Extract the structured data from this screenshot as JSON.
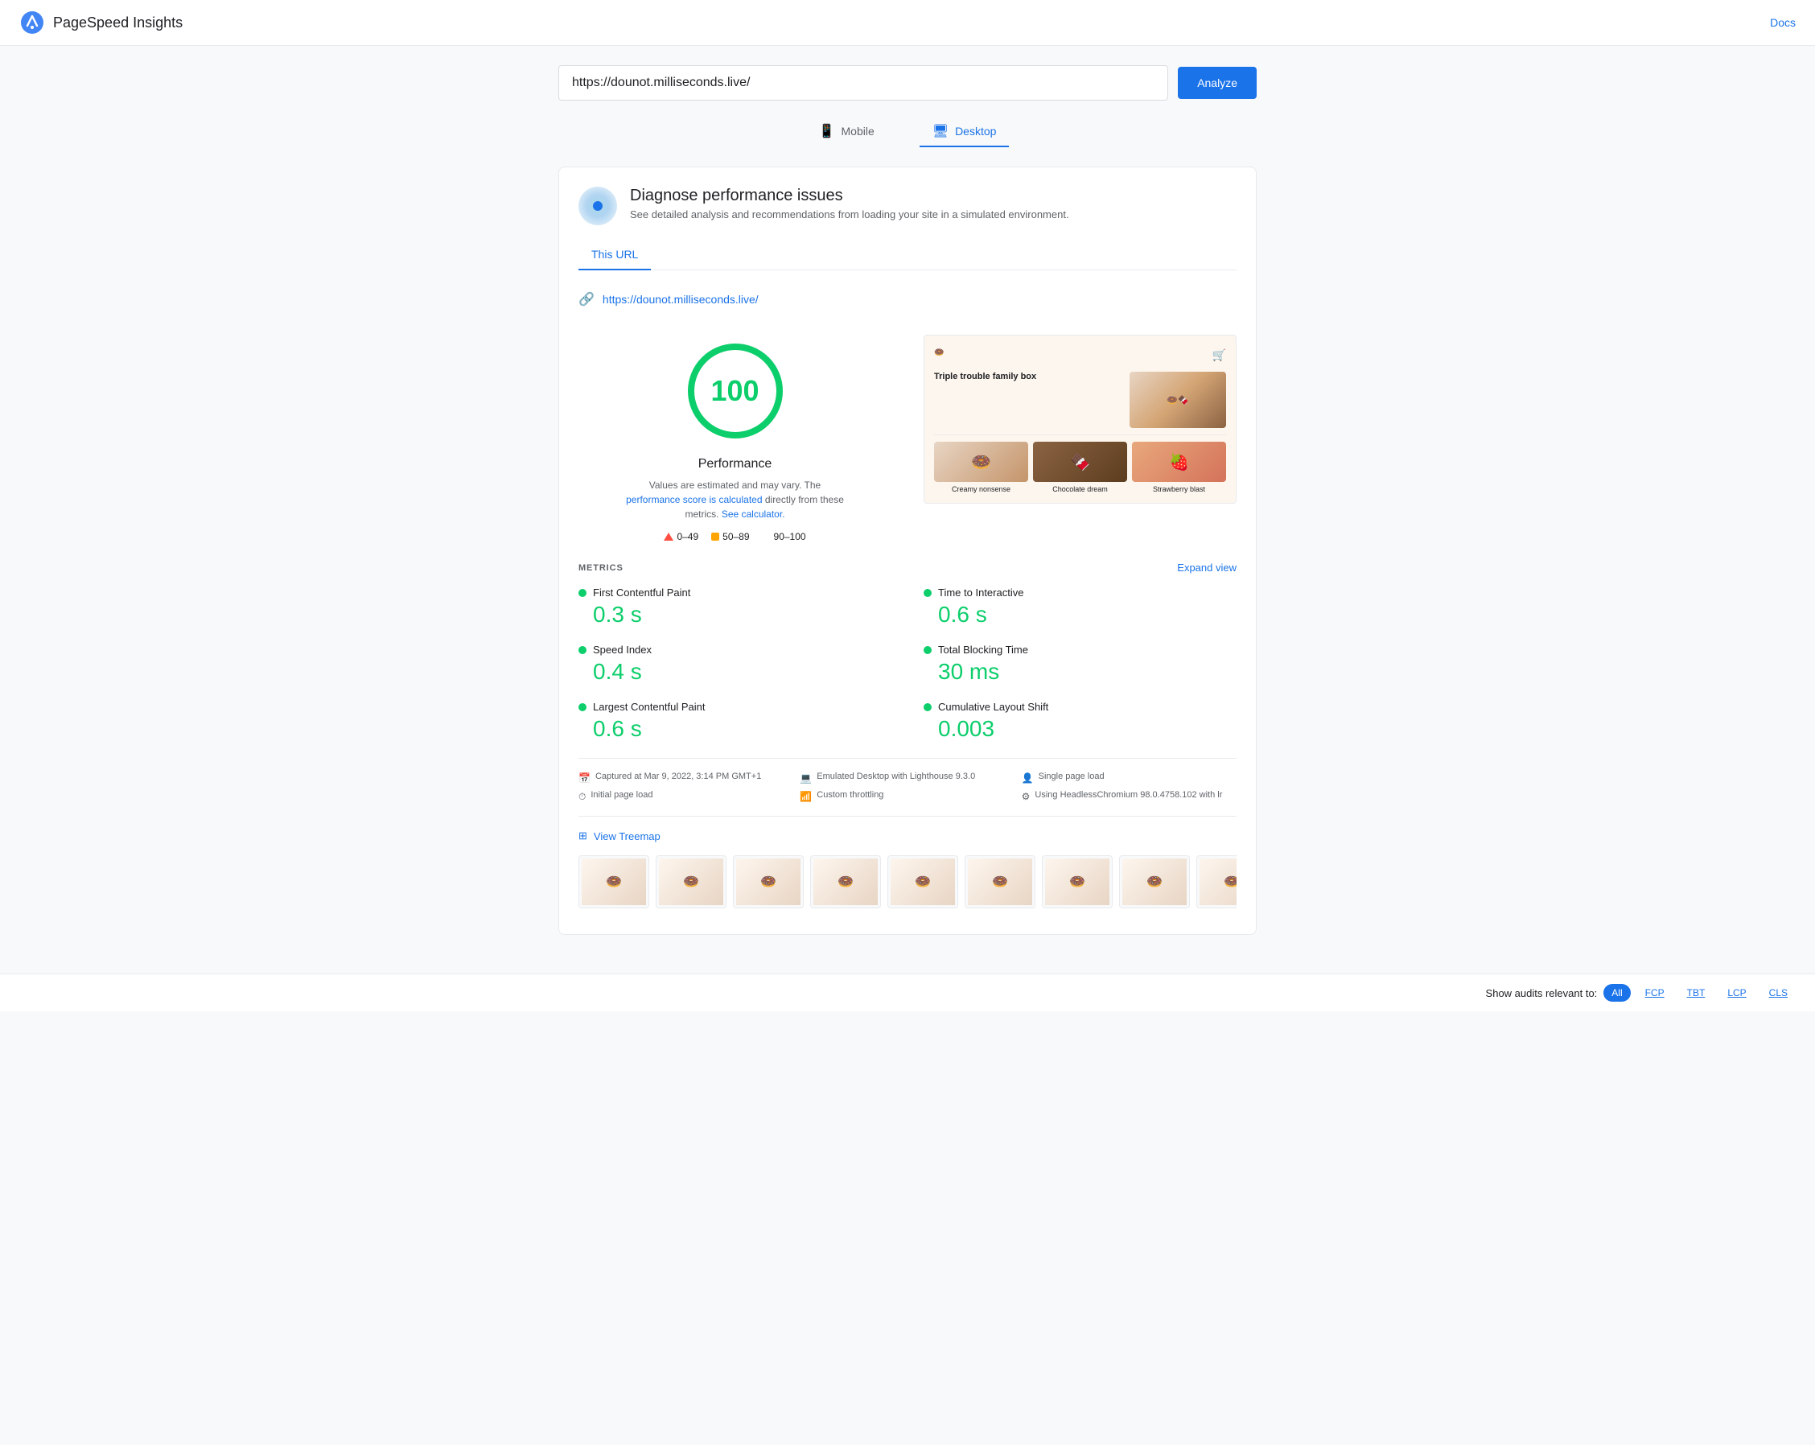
{
  "header": {
    "title": "PageSpeed Insights",
    "docs_label": "Docs"
  },
  "url_bar": {
    "url": "https://dounot.milliseconds.live/",
    "analyze_label": "Analyze"
  },
  "device_tabs": [
    {
      "id": "mobile",
      "label": "Mobile",
      "icon": "📱",
      "active": false
    },
    {
      "id": "desktop",
      "label": "Desktop",
      "icon": "🖥",
      "active": true
    }
  ],
  "diagnose": {
    "title": "Diagnose performance issues",
    "description": "See detailed analysis and recommendations from loading your site in a simulated environment."
  },
  "card_tabs": [
    {
      "id": "this-url",
      "label": "This URL",
      "active": true
    }
  ],
  "url_entry": {
    "url": "https://dounot.milliseconds.live/"
  },
  "score": {
    "value": "100",
    "label": "Performance",
    "note_text": "Values are estimated and may vary. The",
    "note_link_text": "performance score is calculated",
    "note_link2": "See calculator.",
    "note_suffix": "directly from these metrics."
  },
  "legend": [
    {
      "type": "triangle",
      "range": "0–49"
    },
    {
      "type": "square",
      "range": "50–89"
    },
    {
      "type": "circle",
      "range": "90–100"
    }
  ],
  "thumbnail": {
    "brand": "🍩",
    "cart_icon": "🛒",
    "hero_title": "Triple trouble family box",
    "products": [
      {
        "label": "Creamy nonsense",
        "emoji": "🍩"
      },
      {
        "label": "Chocolate dream",
        "emoji": "🍫"
      },
      {
        "label": "Strawberry blast",
        "emoji": "🍓"
      }
    ]
  },
  "metrics_section": {
    "title": "METRICS",
    "expand_label": "Expand view",
    "items": [
      {
        "name": "First Contentful Paint",
        "value": "0.3 s",
        "color": "#0cce6b"
      },
      {
        "name": "Time to Interactive",
        "value": "0.6 s",
        "color": "#0cce6b"
      },
      {
        "name": "Speed Index",
        "value": "0.4 s",
        "color": "#0cce6b"
      },
      {
        "name": "Total Blocking Time",
        "value": "30 ms",
        "color": "#0cce6b"
      },
      {
        "name": "Largest Contentful Paint",
        "value": "0.6 s",
        "color": "#0cce6b"
      },
      {
        "name": "Cumulative Layout Shift",
        "value": "0.003",
        "color": "#0cce6b"
      }
    ]
  },
  "info_bar": {
    "items": [
      {
        "icon": "📅",
        "text": "Captured at Mar 9, 2022, 3:14 PM GMT+1"
      },
      {
        "icon": "💻",
        "text": "Emulated Desktop with Lighthouse 9.3.0"
      },
      {
        "icon": "👤",
        "text": "Single page load"
      },
      {
        "icon": "⏱",
        "text": "Initial page load"
      },
      {
        "icon": "📶",
        "text": "Custom throttling"
      },
      {
        "icon": "⚙",
        "text": "Using HeadlessChromium 98.0.4758.102 with lr"
      }
    ]
  },
  "treemap": {
    "label": "View Treemap"
  },
  "audit_bar": {
    "show_label": "Show audits relevant to:",
    "tags": [
      {
        "label": "All",
        "active": true
      },
      {
        "label": "FCP",
        "active": false
      },
      {
        "label": "TBT",
        "active": false
      },
      {
        "label": "LCP",
        "active": false
      },
      {
        "label": "CLS",
        "active": false
      }
    ]
  }
}
